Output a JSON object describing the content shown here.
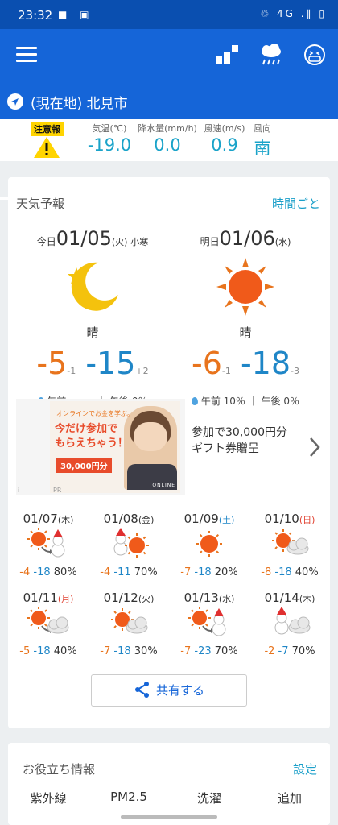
{
  "status": {
    "time": "23:32",
    "left_icons": "■ ▣",
    "right_icons": "♲ 4G .∥ ▯"
  },
  "location": {
    "label": "(現在地) 北見市"
  },
  "observation": {
    "warning_badge": "注意報",
    "temp_label": "気温(℃)",
    "temp": "-19.0",
    "precip_label": "降水量(mm/h)",
    "precip": "0.0",
    "wind_label": "風速(m/s)",
    "wind": "0.9",
    "dir_label": "風向",
    "dir": "南"
  },
  "forecast": {
    "title": "天気予報",
    "hourly_link": "時間ごと",
    "today": {
      "prefix": "今日",
      "date": "01/05",
      "dow": "(火)",
      "note": "小寒",
      "icon": "moon-icon",
      "condition": "晴",
      "high": "-5",
      "high_diff": "-1",
      "low": "-15",
      "low_diff": "+2",
      "am": "午前 −−−",
      "pm": "午後 0％"
    },
    "tomorrow": {
      "prefix": "明日",
      "date": "01/06",
      "dow": "(水)",
      "note": "",
      "icon": "sun-icon",
      "condition": "晴",
      "high": "-6",
      "high_diff": "-1",
      "low": "-18",
      "low_diff": "-3",
      "am": "午前 10％",
      "pm": "午後 0％"
    }
  },
  "ad": {
    "line1": "参加で30,000円分",
    "line2": "ギフト券贈呈",
    "banner_top": "オンラインでお金を学ぶ。",
    "banner_main1": "今だけ参加で",
    "banner_main2": "もらえちゃう！",
    "banner_amount": "30,000円分",
    "pr": "PR",
    "brand": "ONLINE",
    "info": "i"
  },
  "week": [
    {
      "date": "01/07",
      "dow": "(木)",
      "icon": "sun-to-snow-icon",
      "hi": "-4",
      "lo": "-18",
      "pop": "80%"
    },
    {
      "date": "01/08",
      "dow": "(金)",
      "icon": "snow-sun-icon",
      "hi": "-4",
      "lo": "-11",
      "pop": "70%"
    },
    {
      "date": "01/09",
      "dow": "(土)",
      "icon": "sun-icon",
      "hi": "-7",
      "lo": "-18",
      "pop": "20%"
    },
    {
      "date": "01/10",
      "dow": "(日)",
      "icon": "sun-cloud-icon",
      "hi": "-8",
      "lo": "-18",
      "pop": "40%"
    },
    {
      "date": "01/11",
      "dow": "(月)",
      "icon": "sun-to-cloud-icon",
      "hi": "-5",
      "lo": "-18",
      "pop": "40%"
    },
    {
      "date": "01/12",
      "dow": "(火)",
      "icon": "sun-cloud-icon",
      "hi": "-7",
      "lo": "-18",
      "pop": "30%"
    },
    {
      "date": "01/13",
      "dow": "(水)",
      "icon": "sun-to-snow-icon",
      "hi": "-7",
      "lo": "-23",
      "pop": "70%"
    },
    {
      "date": "01/14",
      "dow": "(木)",
      "icon": "snow-cloud-icon",
      "hi": "-2",
      "lo": "-7",
      "pop": "70%"
    }
  ],
  "share": {
    "label": "共有する"
  },
  "useful": {
    "title": "お役立ち情報",
    "settings": "設定",
    "items": [
      "紫外線",
      "PM2.5",
      "洗濯",
      "追加"
    ]
  },
  "colors": {
    "primary": "#1565d8",
    "status_bar": "#0a4fb0",
    "high": "#e8741d",
    "low": "#1f86c7",
    "obs_value": "#1aa3c9",
    "saturday": "#1f86c7",
    "sunday": "#e04030"
  }
}
